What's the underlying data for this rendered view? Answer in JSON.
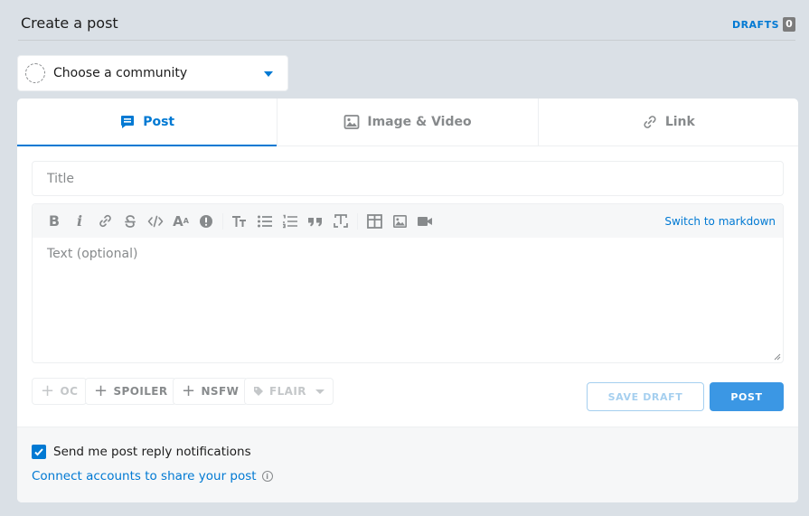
{
  "header": {
    "title": "Create a post",
    "drafts_label": "DRAFTS",
    "drafts_count": "0"
  },
  "community": {
    "label": "Choose a community"
  },
  "tabs": [
    {
      "label": "Post",
      "icon": "post-icon",
      "active": true
    },
    {
      "label": "Image & Video",
      "icon": "image-icon",
      "active": false
    },
    {
      "label": "Link",
      "icon": "link-icon",
      "active": false
    }
  ],
  "title_field": {
    "placeholder": "Title",
    "value": ""
  },
  "editor": {
    "placeholder": "Text (optional)",
    "switch_label": "Switch to markdown",
    "toolbar": [
      "bold-icon",
      "italic-icon",
      "link-icon",
      "strikethrough-icon",
      "inline-code-icon",
      "superscript-icon",
      "spoiler-icon",
      "heading-icon",
      "bulleted-list-icon",
      "numbered-list-icon",
      "quote-block-icon",
      "code-block-icon",
      "table-icon",
      "image-icon",
      "video-icon"
    ]
  },
  "tags": {
    "oc": "OC",
    "spoiler": "SPOILER",
    "nsfw": "NSFW",
    "flair": "FLAIR"
  },
  "actions": {
    "save_draft": "SAVE DRAFT",
    "post": "POST"
  },
  "footer": {
    "notify_label": "Send me post reply notifications",
    "notify_checked": true,
    "connect_label": "Connect accounts to share your post"
  },
  "colors": {
    "accent": "#0079d3",
    "background": "#dae0e6",
    "post_button": "#3b97e4"
  }
}
